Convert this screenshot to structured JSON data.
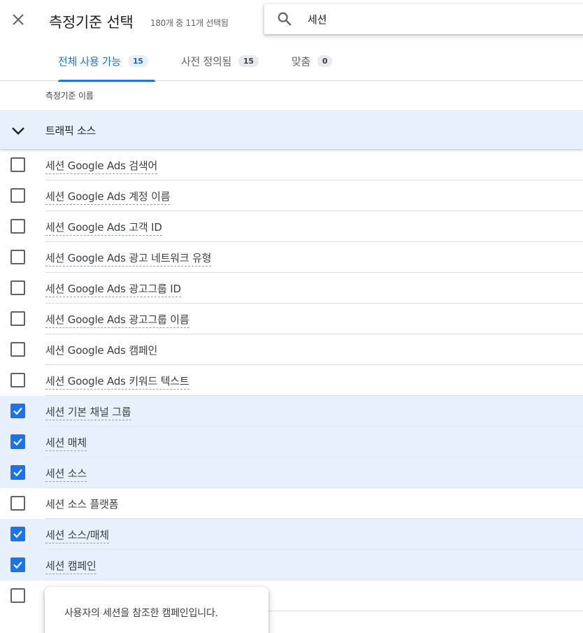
{
  "dialog": {
    "title": "측정기준 선택",
    "subtitle": "180개 중 11개 선택됨"
  },
  "search": {
    "value": "세션"
  },
  "tabs": [
    {
      "label": "전체 사용 가능",
      "count": "15",
      "active": true
    },
    {
      "label": "사전 정의됨",
      "count": "15",
      "active": false
    },
    {
      "label": "맞춤",
      "count": "0",
      "active": false
    }
  ],
  "table": {
    "column_header": "측정기준 이름"
  },
  "group": {
    "label": "트래픽 소스",
    "expanded": true
  },
  "items": [
    {
      "label": "세션 Google Ads 검색어",
      "checked": false,
      "underlined": true
    },
    {
      "label": "세션 Google Ads 계정 이름",
      "checked": false,
      "underlined": true
    },
    {
      "label": "세션 Google Ads 고객 ID",
      "checked": false,
      "underlined": true
    },
    {
      "label": "세션 Google Ads 광고 네트워크 유형",
      "checked": false,
      "underlined": true
    },
    {
      "label": "세션 Google Ads 광고그룹 ID",
      "checked": false,
      "underlined": true
    },
    {
      "label": "세션 Google Ads 광고그룹 이름",
      "checked": false,
      "underlined": true
    },
    {
      "label": "세션 Google Ads 캠페인",
      "checked": false,
      "underlined": false
    },
    {
      "label": "세션 Google Ads 키워드 텍스트",
      "checked": false,
      "underlined": true
    },
    {
      "label": "세션 기본 채널 그룹",
      "checked": true,
      "underlined": true
    },
    {
      "label": "세션 매체",
      "checked": true,
      "underlined": true
    },
    {
      "label": "세션 소스",
      "checked": true,
      "underlined": true
    },
    {
      "label": "세션 소스 플랫폼",
      "checked": false,
      "underlined": false
    },
    {
      "label": "세션 소스/매체",
      "checked": true,
      "underlined": true
    },
    {
      "label": "세션 캠페인",
      "checked": true,
      "underlined": true
    },
    {
      "label": "",
      "checked": false,
      "underlined": false
    }
  ],
  "tooltip": {
    "text": "사용자의 세션을 참조한 캠페인입니다."
  },
  "colors": {
    "accent": "#1a73e8",
    "selected_row": "#e8f0fe",
    "divider": "#dadce0"
  }
}
